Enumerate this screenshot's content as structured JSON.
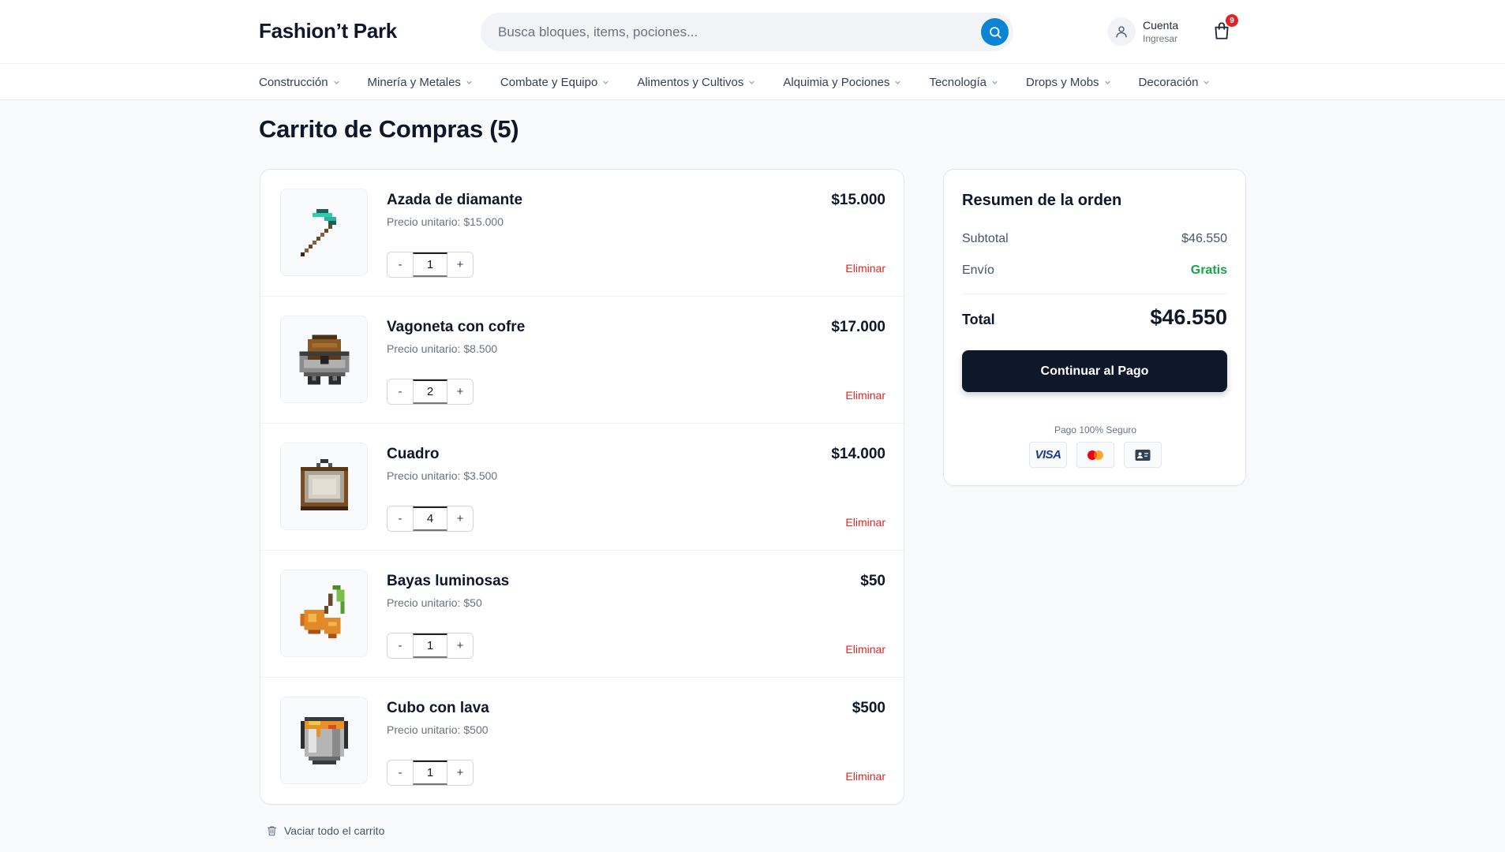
{
  "header": {
    "brand": "Fashion’t Park",
    "search_placeholder": "Busca bloques, items, pociones...",
    "search_value": "",
    "account_title": "Cuenta",
    "account_sub": "Ingresar",
    "cart_count": "9"
  },
  "nav": {
    "items": [
      {
        "label": "Construcción"
      },
      {
        "label": "Minería y Metales"
      },
      {
        "label": "Combate y Equipo"
      },
      {
        "label": "Alimentos y Cultivos"
      },
      {
        "label": "Alquimia y Pociones"
      },
      {
        "label": "Tecnología"
      },
      {
        "label": "Drops y Mobs"
      },
      {
        "label": "Decoración"
      }
    ]
  },
  "page": {
    "title": "Carrito de Compras (5)"
  },
  "cart": {
    "unit_label": "Precio unitario:",
    "remove_label": "Eliminar",
    "minus": "-",
    "plus": "+",
    "items": [
      {
        "name": "Azada de diamante",
        "unit_price": "$15.000",
        "qty": "1",
        "total": "$15.000",
        "icon": "diamond-hoe-icon"
      },
      {
        "name": "Vagoneta con cofre",
        "unit_price": "$8.500",
        "qty": "2",
        "total": "$17.000",
        "icon": "chest-minecart-icon"
      },
      {
        "name": "Cuadro",
        "unit_price": "$3.500",
        "qty": "4",
        "total": "$14.000",
        "icon": "painting-icon"
      },
      {
        "name": "Bayas luminosas",
        "unit_price": "$50",
        "qty": "1",
        "total": "$50",
        "icon": "glow-berries-icon"
      },
      {
        "name": "Cubo con lava",
        "unit_price": "$500",
        "qty": "1",
        "total": "$500",
        "icon": "lava-bucket-icon"
      }
    ],
    "clear_label": "Vaciar todo el carrito"
  },
  "summary": {
    "title": "Resumen de la orden",
    "subtotal_label": "Subtotal",
    "subtotal_value": "$46.550",
    "shipping_label": "Envío",
    "shipping_value": "Gratis",
    "total_label": "Total",
    "total_value": "$46.550",
    "checkout_label": "Continuar al Pago",
    "secure_label": "Pago 100% Seguro",
    "visa_label": "VISA",
    "payment_icons": [
      "visa-icon",
      "mastercard-icon",
      "id-card-icon"
    ]
  },
  "colors": {
    "accent": "#0b84d3",
    "dark": "#0f172a",
    "danger": "#dc2626",
    "success": "#16a34a"
  }
}
